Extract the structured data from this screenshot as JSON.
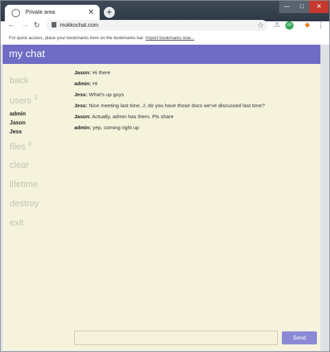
{
  "browser": {
    "tab_title": "Private area",
    "tab_close_glyph": "✕",
    "new_tab_glyph": "+",
    "window_controls": {
      "minimize": "—",
      "maximize": "□",
      "close": "✕"
    },
    "nav": {
      "back_glyph": "←",
      "forward_glyph": "→",
      "reload_glyph": "↻"
    },
    "url": "mokkochat.com",
    "star_glyph": "☆",
    "extensions": {
      "warning_glyph": "⚠",
      "avatar_initials": "AP",
      "fox_glyph": "◆"
    },
    "menu_glyph": "⋮",
    "bookmarks_bar": {
      "text": "For quick access, place your bookmarks here on the bookmarks bar.",
      "link": "Import bookmarks now..."
    }
  },
  "app": {
    "title": "my chat",
    "colors": {
      "header": "#6e6cc4",
      "background": "#f5f3dc",
      "send_button": "#8b89d6"
    }
  },
  "sidebar": {
    "back": "back",
    "users_label": "users",
    "users_count": "3",
    "users": [
      "admin",
      "Jason",
      "Jess"
    ],
    "files_label": "files",
    "files_count": "0",
    "clear": "clear",
    "lifetime": "lifetime",
    "destroy": "destroy",
    "exit": "exit"
  },
  "messages": [
    {
      "author": "Jason:",
      "text": "Hi there"
    },
    {
      "author": "admin:",
      "text": "Hi"
    },
    {
      "author": "Jess:",
      "text": "What's up guys"
    },
    {
      "author": "Jess:",
      "text": "Nice meeting last time. J, do you have those docs we've discussed last time?"
    },
    {
      "author": "Jason:",
      "text": "Actually, admin has them. Pls share"
    },
    {
      "author": "admin:",
      "text": "yep, coming right up"
    }
  ],
  "composer": {
    "value": "",
    "send_label": "Send"
  }
}
